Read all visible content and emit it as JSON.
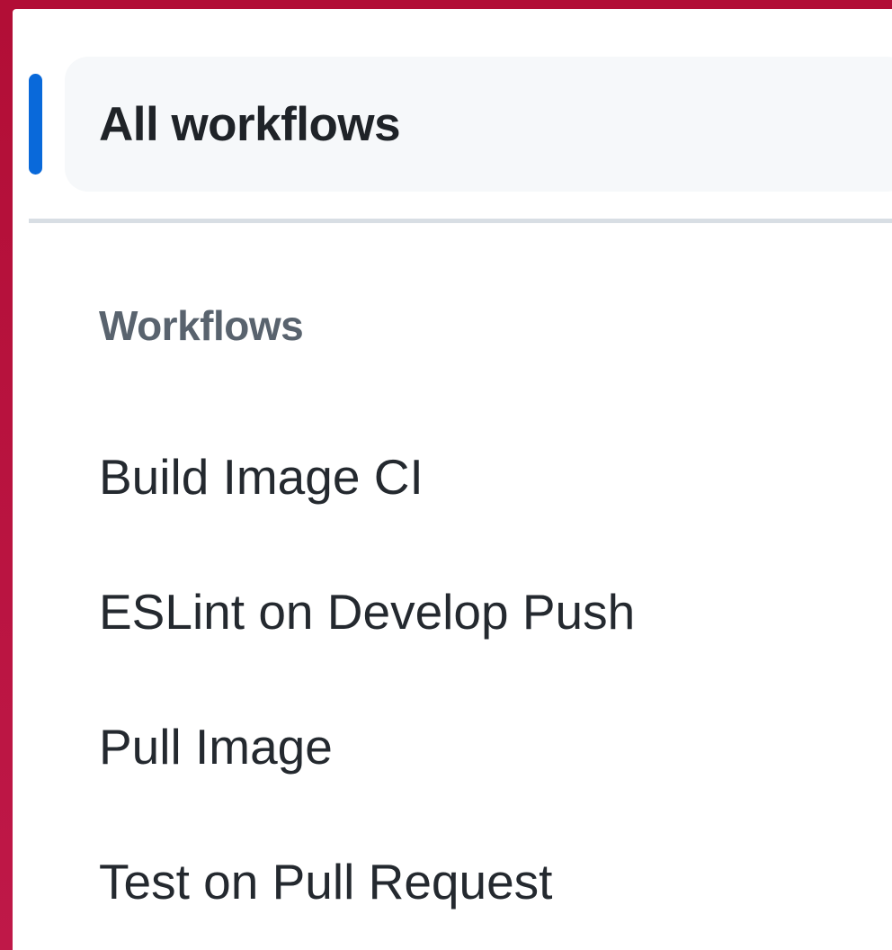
{
  "nav": {
    "all_workflows_label": "All workflows"
  },
  "workflows": {
    "heading": "Workflows",
    "items": [
      {
        "label": "Build Image CI"
      },
      {
        "label": "ESLint on Develop Push"
      },
      {
        "label": "Pull Image"
      },
      {
        "label": "Test on Pull Request"
      }
    ]
  },
  "colors": {
    "accent": "#0969da",
    "background_frame": "#b20e36",
    "active_item_bg": "#f6f8fa"
  }
}
